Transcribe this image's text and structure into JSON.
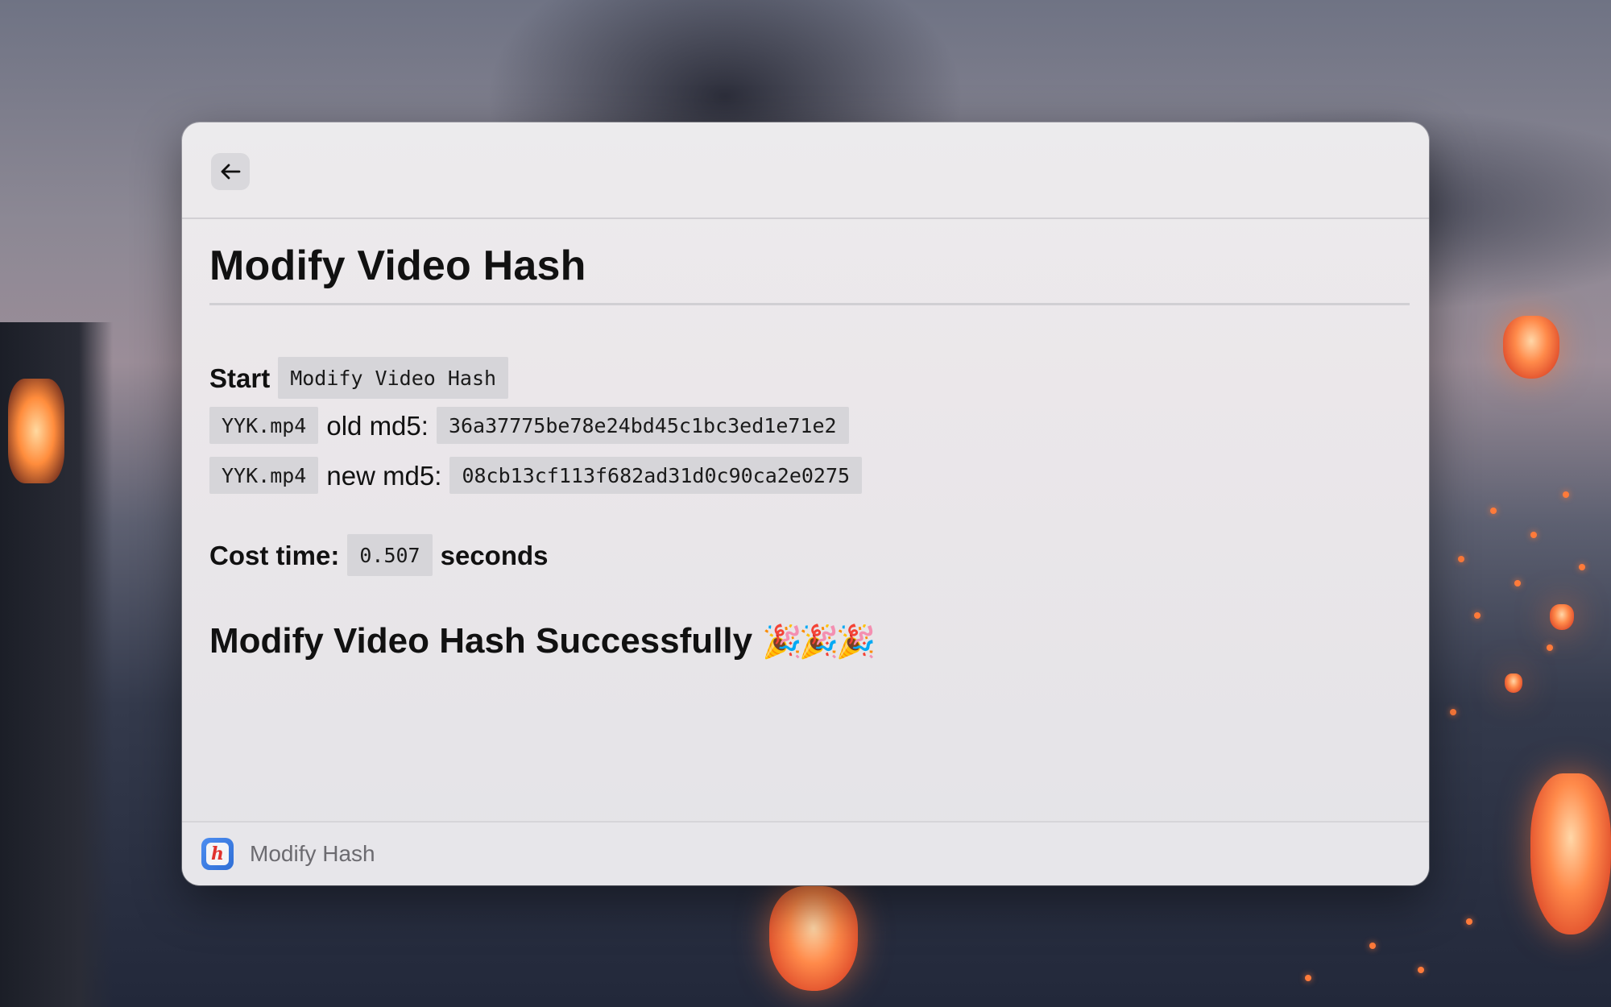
{
  "window": {
    "back_icon": "arrow-left-icon"
  },
  "main": {
    "title": "Modify Video Hash",
    "start_label": "Start",
    "start_value": "Modify Video Hash",
    "rows": [
      {
        "file": "YYK.mp4",
        "label": "old md5:",
        "hash": "36a37775be78e24bd45c1bc3ed1e71e2"
      },
      {
        "file": "YYK.mp4",
        "label": "new md5:",
        "hash": "08cb13cf113f682ad31d0c90ca2e0275"
      }
    ],
    "cost_label": "Cost time:",
    "cost_value": "0.507",
    "cost_unit": "seconds",
    "success_text": "Modify Video Hash Successfully",
    "success_emoji": "🎉🎉🎉"
  },
  "footer": {
    "app_icon": "modify-hash-app-icon",
    "app_name": "Modify Hash"
  },
  "colors": {
    "window_bg": "#ebe7ea",
    "code_bg": "#d6d5d9",
    "accent_icon": "#2f6fd6",
    "icon_glyph": "#e0322d"
  }
}
